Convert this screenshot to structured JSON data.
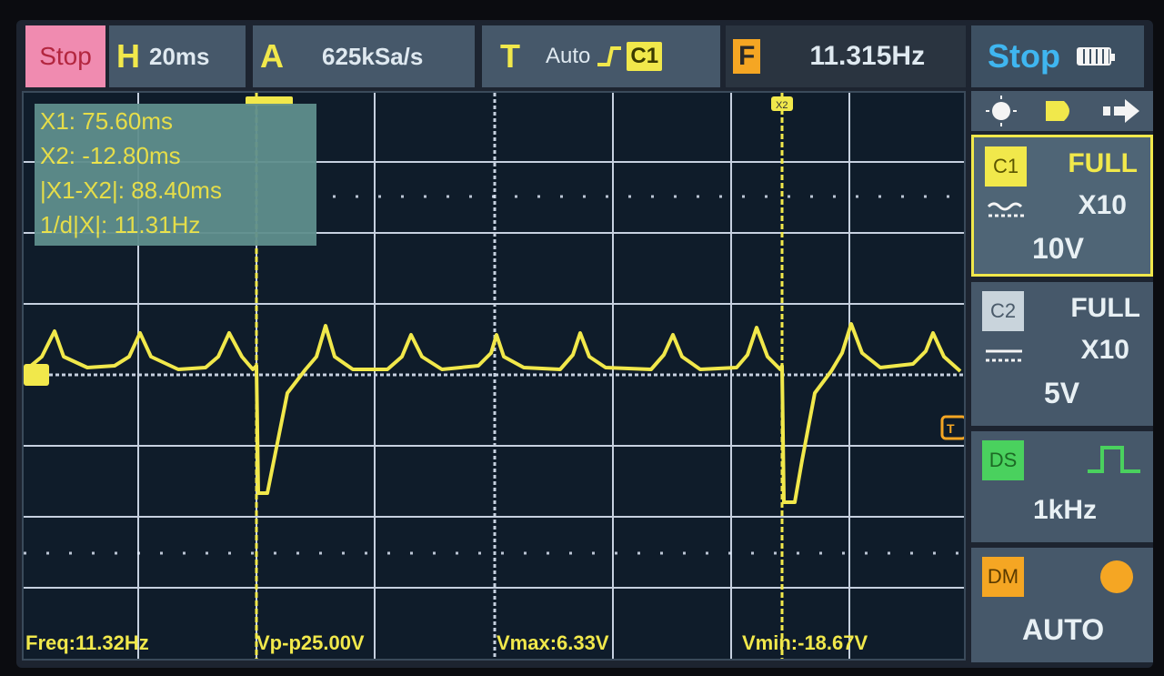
{
  "topbar": {
    "run_state_button": "Stop",
    "horizontal": {
      "key": "H",
      "value": "20ms"
    },
    "acquisition": {
      "key": "A",
      "value": "625kSa/s"
    },
    "trigger": {
      "key": "T",
      "mode": "Auto",
      "source": "C1"
    },
    "frequency": {
      "key": "F",
      "value": "11.315Hz"
    },
    "status": "Stop"
  },
  "cursors": {
    "x1": "X1: 75.60ms",
    "x2": "X2: -12.80ms",
    "delta": "|X1-X2|: 88.40ms",
    "inverse": "1/d|X|: 11.31Hz",
    "marker_x1": "X1",
    "marker_x2": "X2"
  },
  "measurements": {
    "freq": "Freq:11.32Hz",
    "vpp": "Vp-p25.00V",
    "vmax": "Vmax:6.33V",
    "vmin": "Vmin:-18.67V"
  },
  "panel": {
    "c1": {
      "label": "C1",
      "range": "FULL",
      "probe": "X10",
      "volts_div": "10V"
    },
    "c2": {
      "label": "C2",
      "range": "FULL",
      "probe": "X10",
      "volts_div": "5V"
    },
    "ds": {
      "label": "DS",
      "freq": "1kHz"
    },
    "dm": {
      "label": "DM",
      "mode": "AUTO"
    }
  },
  "colors": {
    "trace": "#f1e84b",
    "grid": "#e6f0ff",
    "screen_bg": "#0f1c2a",
    "panel_bg": "#46586a",
    "stop_button": "#f08bb0",
    "stop_text": "#3fb6f0"
  }
}
